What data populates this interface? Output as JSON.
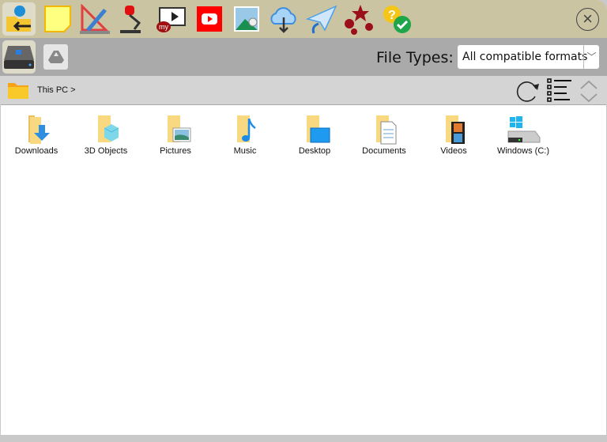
{
  "toolbar": {
    "icons": [
      "open-file-icon",
      "sticky-note-icon",
      "drawing-tools-icon",
      "document-camera-icon",
      "my-video-icon",
      "youtube-icon",
      "image-search-icon",
      "cloud-download-icon",
      "send-icon",
      "fireworks-icon",
      "quiz-check-icon"
    ],
    "close_icon": "close-icon"
  },
  "sources": {
    "local_drive": "local-drive-icon",
    "google_drive": "google-drive-icon"
  },
  "filter": {
    "label": "File Types:",
    "selected": "All compatible formats"
  },
  "breadcrumb": {
    "path": "This PC >"
  },
  "items": [
    {
      "label": "Downloads"
    },
    {
      "label": "3D Objects"
    },
    {
      "label": "Pictures"
    },
    {
      "label": "Music"
    },
    {
      "label": "Desktop"
    },
    {
      "label": "Documents"
    },
    {
      "label": "Videos"
    },
    {
      "label": "Windows (C:)"
    }
  ],
  "colors": {
    "toolbar": "#cbc4a2",
    "sourcebar": "#aaaaaa",
    "pathbar": "#d4d4d4",
    "folder": "#f5d26e"
  }
}
